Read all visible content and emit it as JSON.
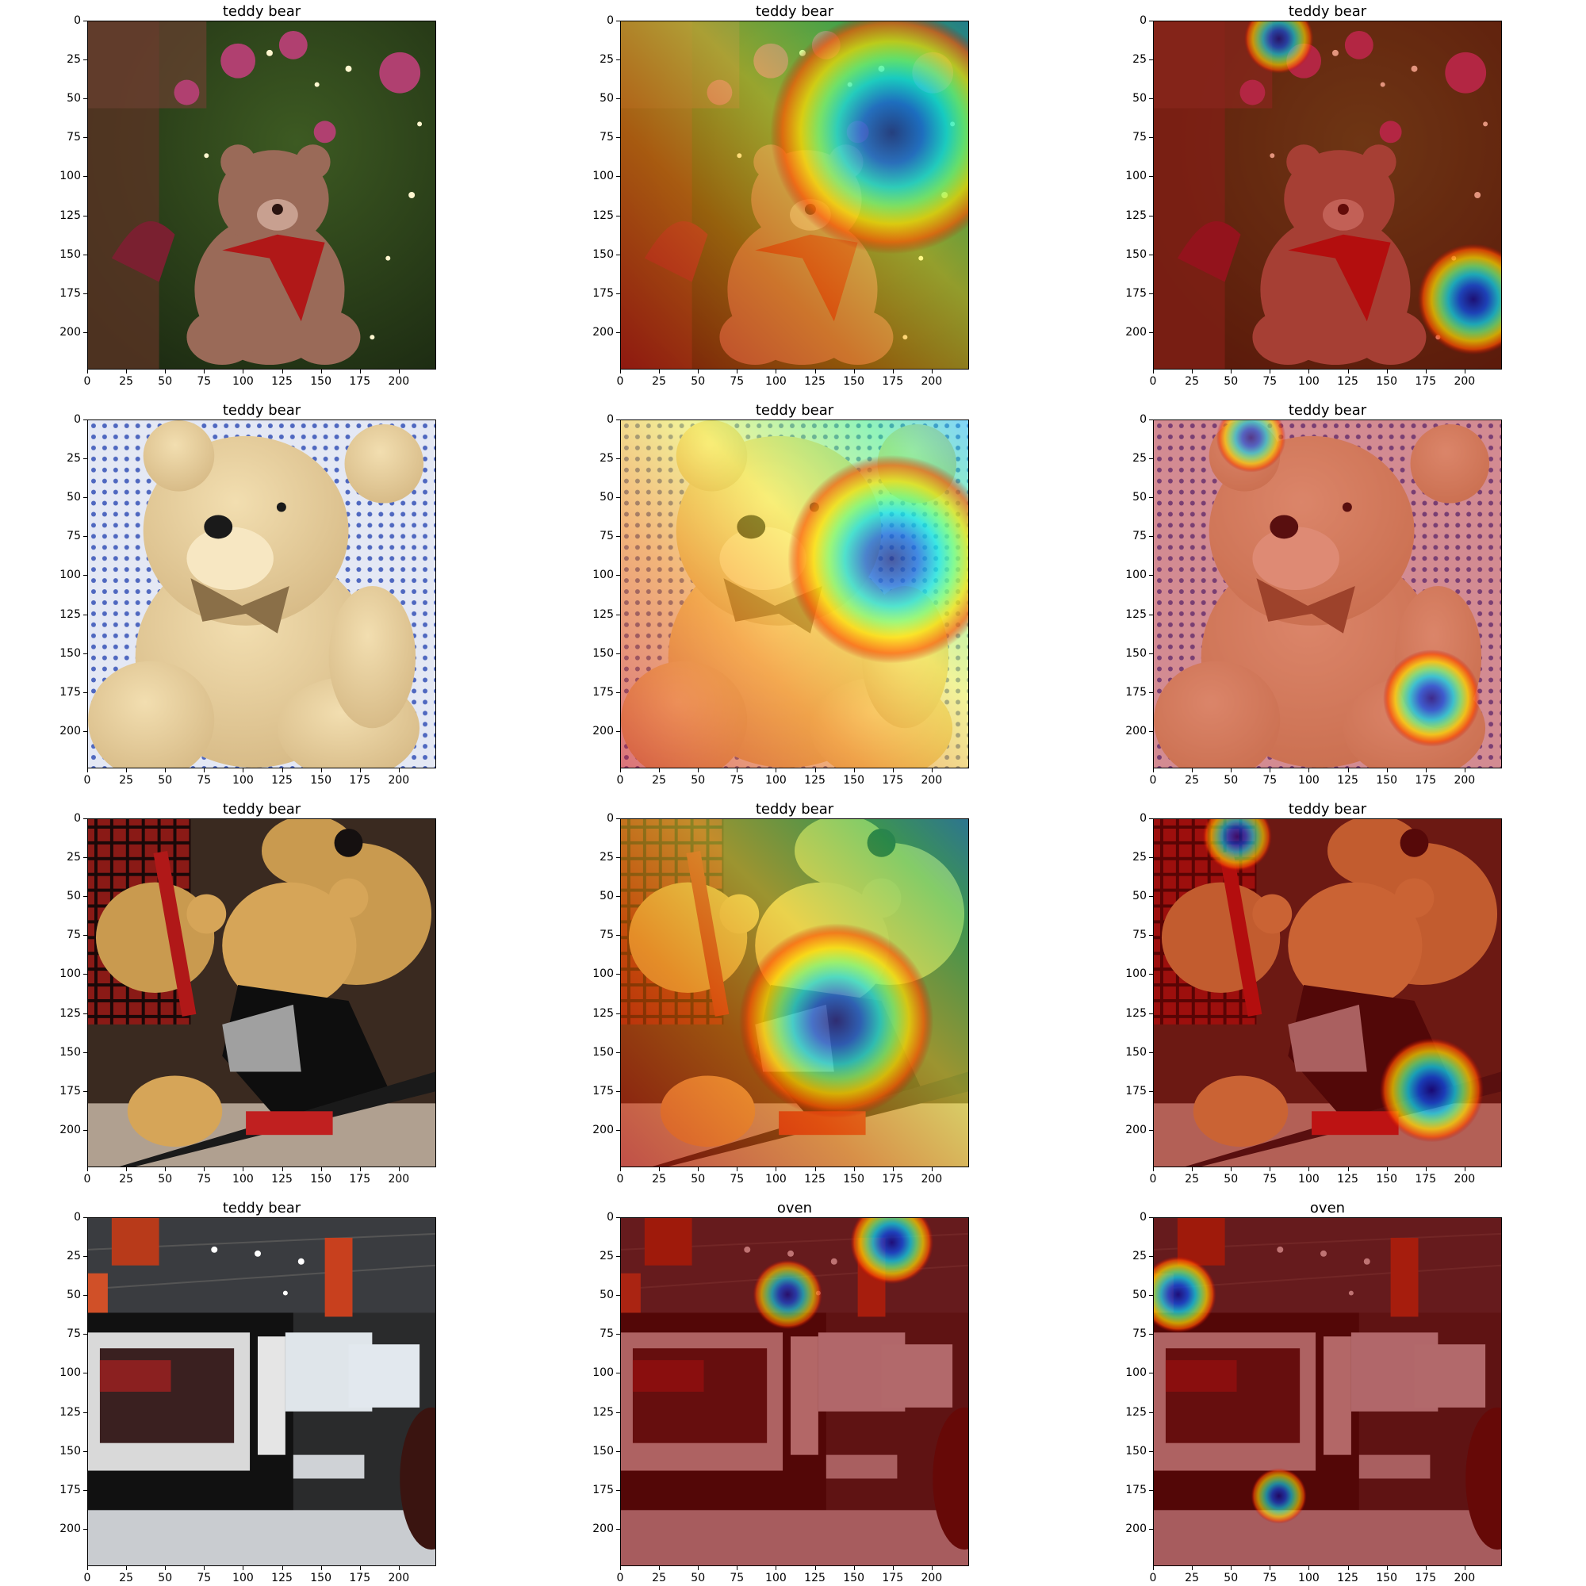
{
  "figure": {
    "rows": [
      {
        "scene": "christmas-tree-bear",
        "panels": [
          {
            "title": "teddy bear",
            "overlay": "none"
          },
          {
            "title": "teddy bear",
            "overlay": "heatmap-a",
            "heat": {
              "cold": [
                0.78,
                0.32
              ],
              "radius": 0.35,
              "warm": "lower-left"
            }
          },
          {
            "title": "teddy bear",
            "overlay": "heatmap-b",
            "heat": {
              "cold": [
                0.92,
                0.8
              ],
              "radius": 0.16,
              "cold2": [
                0.36,
                0.05
              ],
              "radius2": 0.1
            }
          }
        ]
      },
      {
        "scene": "cream-bear-lace",
        "panels": [
          {
            "title": "teddy bear",
            "overlay": "none"
          },
          {
            "title": "teddy bear",
            "overlay": "heatmap-a",
            "heat": {
              "cold": [
                0.78,
                0.4
              ],
              "radius": 0.3,
              "warm": "lower-left"
            }
          },
          {
            "title": "teddy bear",
            "overlay": "heatmap-b",
            "heat": {
              "cold": [
                0.8,
                0.8
              ],
              "radius": 0.14,
              "cold2": [
                0.28,
                0.05
              ],
              "radius2": 0.1
            }
          }
        ]
      },
      {
        "scene": "hockey-bears",
        "panels": [
          {
            "title": "teddy bear",
            "overlay": "none"
          },
          {
            "title": "teddy bear",
            "overlay": "heatmap-a",
            "heat": {
              "cold": [
                0.62,
                0.58
              ],
              "radius": 0.28,
              "warm": "left"
            }
          },
          {
            "title": "teddy bear",
            "overlay": "heatmap-b",
            "heat": {
              "cold": [
                0.8,
                0.78
              ],
              "radius": 0.15,
              "cold2": [
                0.24,
                0.05
              ],
              "radius2": 0.1
            }
          }
        ]
      },
      {
        "scene": "microwave-office",
        "panels": [
          {
            "title": "teddy bear",
            "overlay": "none"
          },
          {
            "title": "oven",
            "overlay": "heatmap-c",
            "heat": {
              "cold": [
                0.78,
                0.07
              ],
              "radius": 0.12,
              "cold2": [
                0.48,
                0.22
              ],
              "radius2": 0.1
            }
          },
          {
            "title": "oven",
            "overlay": "heatmap-c",
            "heat": {
              "cold": [
                0.07,
                0.22
              ],
              "radius": 0.11,
              "cold2": [
                0.36,
                0.8
              ],
              "radius2": 0.08
            }
          }
        ]
      }
    ],
    "axis": {
      "y_ticks": [
        "0",
        "25",
        "50",
        "75",
        "100",
        "125",
        "150",
        "175",
        "200"
      ],
      "x_ticks": [
        "0",
        "25",
        "50",
        "75",
        "100",
        "125",
        "150",
        "175",
        "200"
      ],
      "extent": 224
    },
    "colormap": "jet"
  }
}
